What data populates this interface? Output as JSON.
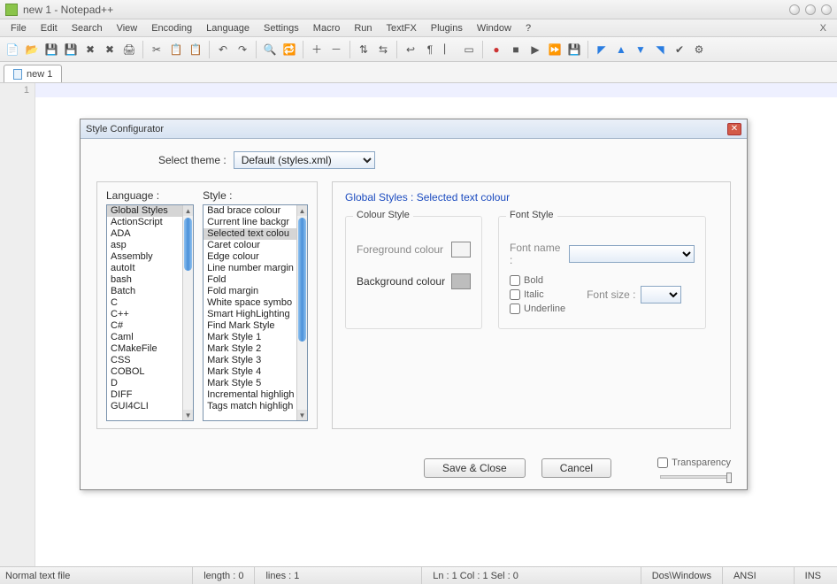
{
  "window": {
    "title": "new  1 - Notepad++"
  },
  "menubar": [
    "File",
    "Edit",
    "Search",
    "View",
    "Encoding",
    "Language",
    "Settings",
    "Macro",
    "Run",
    "TextFX",
    "Plugins",
    "Window",
    "?"
  ],
  "tabs": [
    {
      "label": "new  1"
    }
  ],
  "gutter_line": "1",
  "status": {
    "filetype": "Normal text file",
    "length": "length : 0",
    "lines": "lines : 1",
    "pos": "Ln : 1   Col : 1   Sel : 0",
    "eol": "Dos\\Windows",
    "enc": "ANSI",
    "mode": "INS"
  },
  "dialog": {
    "title": "Style Configurator",
    "theme_label": "Select theme :",
    "theme_value": "Default (styles.xml)",
    "language_label": "Language :",
    "style_label": "Style :",
    "languages": [
      "Global Styles",
      "ActionScript",
      "ADA",
      "asp",
      "Assembly",
      "autoIt",
      "bash",
      "Batch",
      "C",
      "C++",
      "C#",
      "Caml",
      "CMakeFile",
      "CSS",
      "COBOL",
      "D",
      "DIFF",
      "GUI4CLI"
    ],
    "language_selected": 0,
    "styles": [
      "Bad brace colour",
      "Current line backgr",
      "Selected text colou",
      "Caret colour",
      "Edge colour",
      "Line number margin",
      "Fold",
      "Fold margin",
      "White space symbo",
      "Smart HighLighting",
      "Find Mark Style",
      "Mark Style 1",
      "Mark Style 2",
      "Mark Style 3",
      "Mark Style 4",
      "Mark Style 5",
      "Incremental highligh",
      "Tags match highligh"
    ],
    "style_selected": 2,
    "breadcrumb": "Global Styles : Selected text colour",
    "colour_group": {
      "legend": "Colour Style",
      "fg_label": "Foreground colour",
      "bg_label": "Background colour"
    },
    "font_group": {
      "legend": "Font Style",
      "name_label": "Font name :",
      "size_label": "Font size :",
      "bold": "Bold",
      "italic": "Italic",
      "underline": "Underline"
    },
    "save_close": "Save & Close",
    "cancel": "Cancel",
    "transparency": "Transparency"
  }
}
